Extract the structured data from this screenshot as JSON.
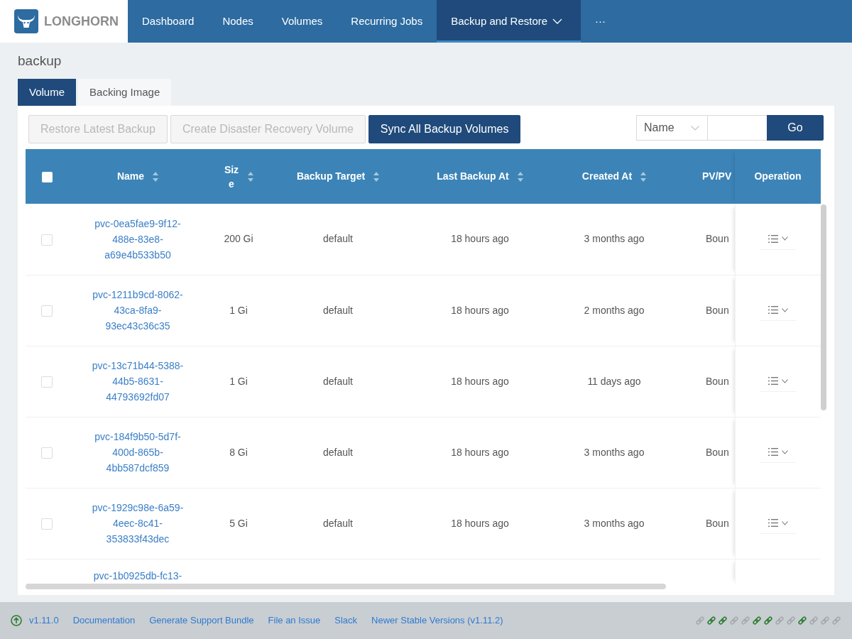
{
  "navbar": {
    "logo_text": "LONGHORN",
    "items": [
      {
        "label": "Dashboard",
        "selected": false,
        "kind": "link"
      },
      {
        "label": "Nodes",
        "selected": false,
        "kind": "link"
      },
      {
        "label": "Volumes",
        "selected": false,
        "kind": "link"
      },
      {
        "label": "Recurring Jobs",
        "selected": false,
        "kind": "link"
      },
      {
        "label": "Backup and Restore",
        "selected": true,
        "kind": "dropdown"
      },
      {
        "label": "···",
        "selected": false,
        "kind": "link"
      }
    ]
  },
  "page_title": "backup",
  "tabs": [
    {
      "label": "Volume",
      "selected": true
    },
    {
      "label": "Backing Image",
      "selected": false
    }
  ],
  "toolbar": {
    "buttons": [
      {
        "label": "Restore Latest Backup",
        "disabled": true,
        "kind": "default"
      },
      {
        "label": "Create Disaster Recovery Volume",
        "disabled": true,
        "kind": "default"
      },
      {
        "label": "Sync All Backup Volumes",
        "disabled": false,
        "kind": "primary"
      }
    ],
    "filter": {
      "field": "Name",
      "go_button": "Go"
    }
  },
  "table": {
    "header_checked": false,
    "columns": [
      {
        "label": "Name",
        "sort_icon": true
      },
      {
        "label": "Size",
        "sort_icon": true
      },
      {
        "label": "Backup Target",
        "sort_icon": true
      },
      {
        "label": "Last Backup At",
        "sort_icon": true
      },
      {
        "label": "Created At",
        "sort_icon": true
      },
      {
        "label": "PV/PV",
        "sort_icon": false
      },
      {
        "label": "Operation",
        "sort_icon": false
      }
    ],
    "rows": [
      {
        "checked": false,
        "name": "pvc-0ea5fae9-9f12-488e-83e8-a69e4b533b50",
        "size": "200 Gi",
        "backup_target": "default",
        "last_backup_at": "18 hours ago",
        "created_at": "3 months ago",
        "column_7": "Boun"
      },
      {
        "checked": false,
        "name": "pvc-1211b9cd-8062-43ca-8fa9-93ec43c36c35",
        "size": "1 Gi",
        "backup_target": "default",
        "last_backup_at": "18 hours ago",
        "created_at": "2 months ago",
        "column_7": "Boun"
      },
      {
        "checked": false,
        "name": "pvc-13c71b44-5388-44b5-8631-44793692fd07",
        "size": "1 Gi",
        "backup_target": "default",
        "last_backup_at": "18 hours ago",
        "created_at": "11 days ago",
        "column_7": "Boun"
      },
      {
        "checked": false,
        "name": "pvc-184f9b50-5d7f-400d-865b-4bb587dcf859",
        "size": "8 Gi",
        "backup_target": "default",
        "last_backup_at": "18 hours ago",
        "created_at": "3 months ago",
        "column_7": "Boun"
      },
      {
        "checked": false,
        "name": "pvc-1929c98e-6a59-4eec-8c41-353833f43dec",
        "size": "5 Gi",
        "backup_target": "default",
        "last_backup_at": "18 hours ago",
        "created_at": "3 months ago",
        "column_7": "Boun"
      }
    ],
    "partial_row": {
      "name": "pvc-1b0925db-fc13-"
    }
  },
  "footer": {
    "upgrade_available": true,
    "version": "v1.11.0",
    "links": [
      "Documentation",
      "Generate Support Bundle",
      "File an Issue",
      "Slack",
      "Newer Stable Versions (v1.11.2)"
    ],
    "connections": [
      {
        "connected": false
      },
      {
        "connected": true
      },
      {
        "connected": true
      },
      {
        "connected": false
      },
      {
        "connected": false
      },
      {
        "connected": true
      },
      {
        "connected": true
      },
      {
        "connected": false
      },
      {
        "connected": false
      },
      {
        "connected": true
      },
      {
        "connected": false
      },
      {
        "connected": false
      },
      {
        "connected": false
      }
    ]
  }
}
